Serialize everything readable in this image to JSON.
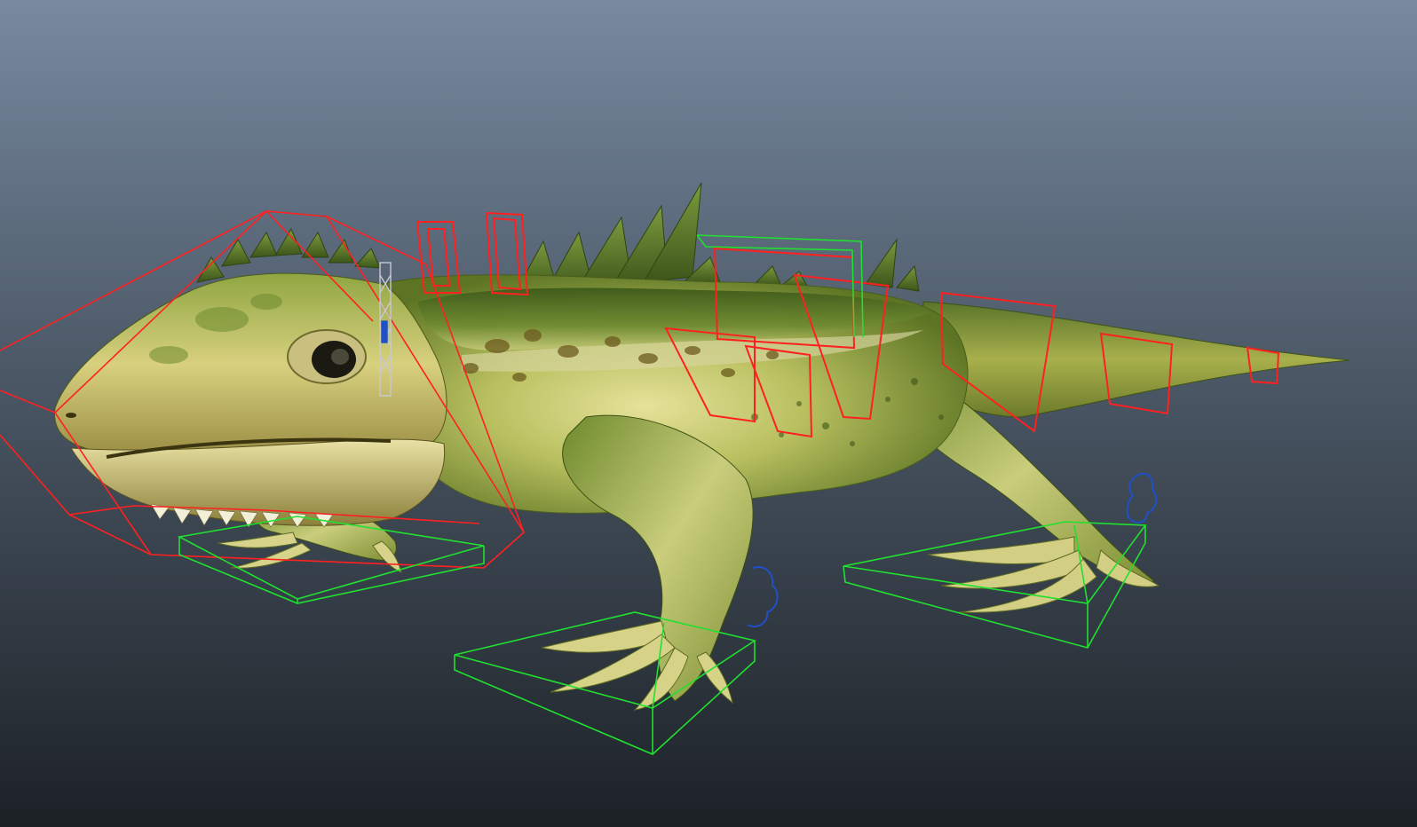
{
  "viewport": {
    "background_top": "#788aa0",
    "background_bottom": "#1c2126"
  },
  "model": {
    "skin_light": "#e6e29a",
    "skin_mid": "#a9b84a",
    "skin_dark": "#4f6b1d",
    "back_dark": "#3e5a1a"
  },
  "rig_controls": {
    "fk_color": "#ff2020",
    "ik_color": "#20e030",
    "pole_color": "#1f50c8",
    "joint_color": "#c8c8d2"
  }
}
